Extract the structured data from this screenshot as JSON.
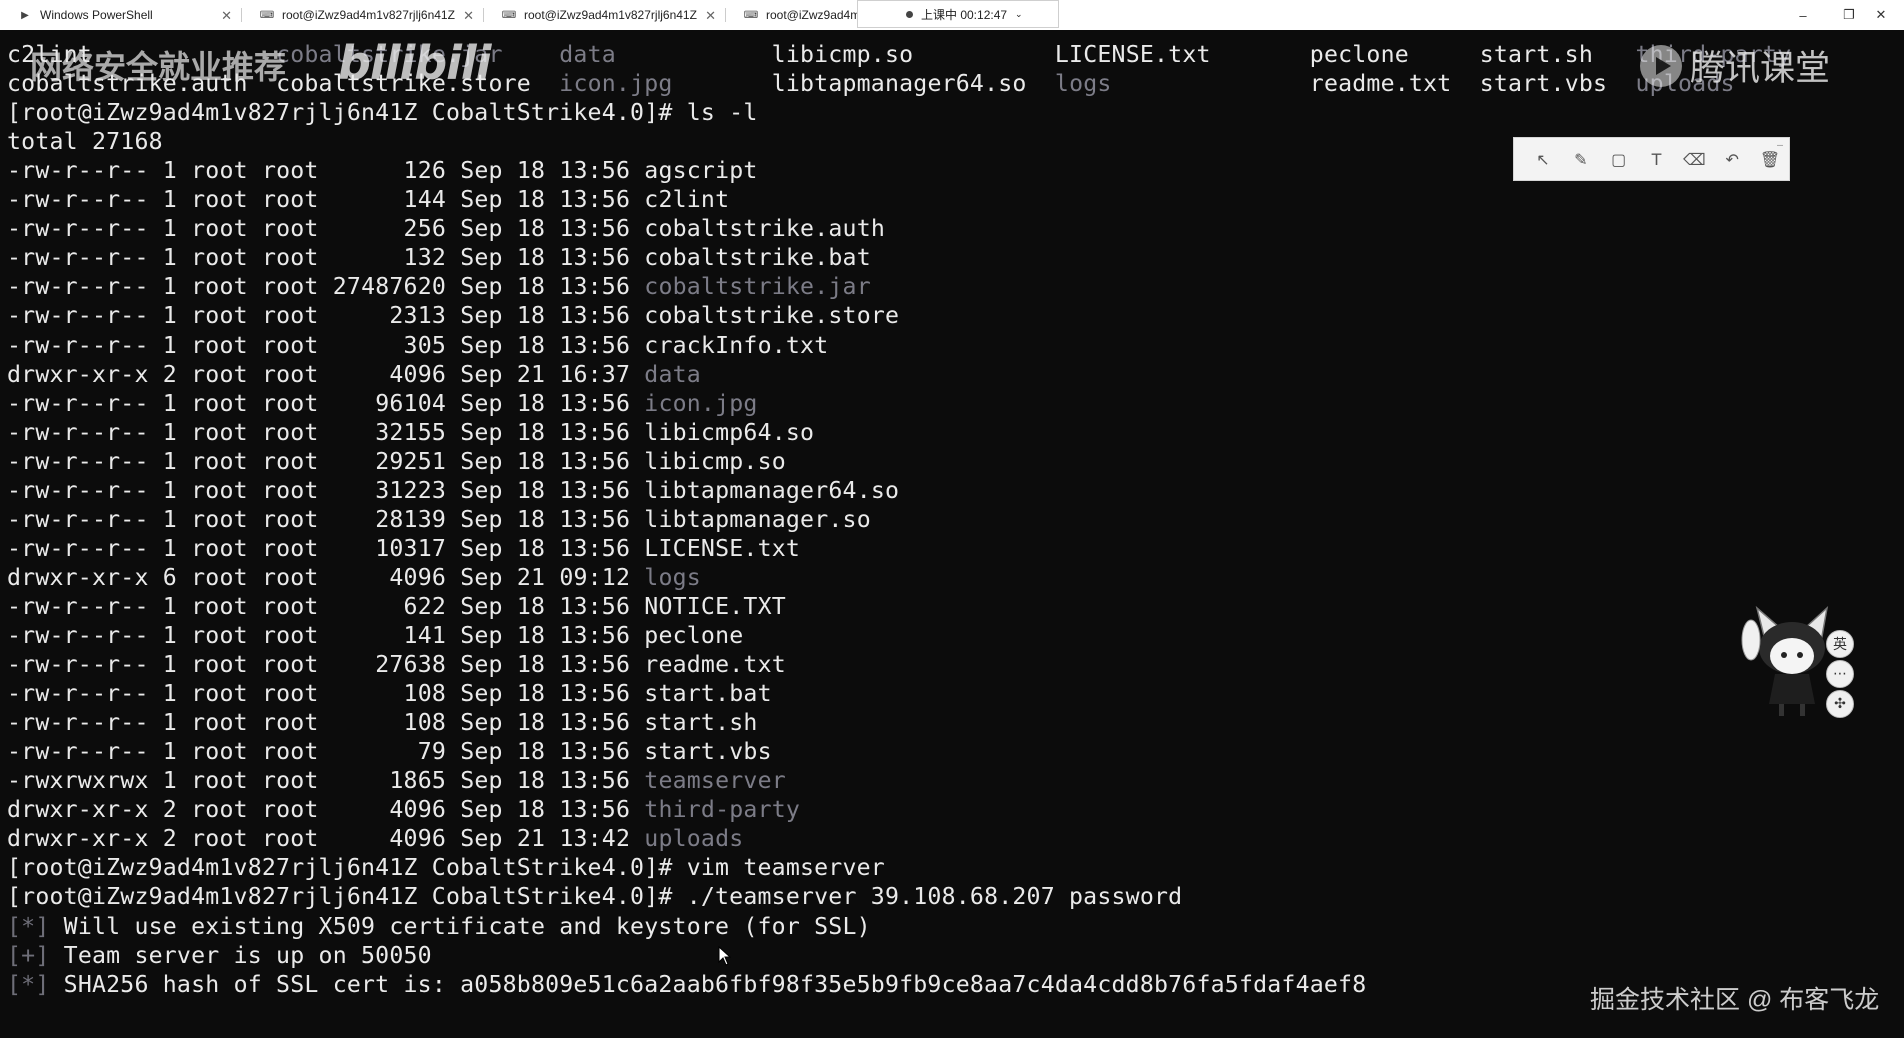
{
  "tabs": [
    {
      "label": "Windows PowerShell",
      "icon": "powershell-icon"
    },
    {
      "label": "root@iZwz9ad4m1v827rjlj6n41Z",
      "icon": "terminal-icon"
    },
    {
      "label": "root@iZwz9ad4m1v827rjlj6n41Z",
      "icon": "terminal-icon"
    },
    {
      "label": "root@iZwz9ad4m",
      "icon": "terminal-icon"
    }
  ],
  "recording": {
    "status": "上课中 00:12:47",
    "dropdown_icon": "chevron-down-icon"
  },
  "window_controls": {
    "minimize": "–",
    "maximize": "❐",
    "close": "✕"
  },
  "terminal": {
    "top_listing": [
      [
        "c2lint",
        "cobaltstrike.jar",
        "data",
        "libicmp.so",
        "LICENSE.txt",
        "peclone",
        "start.sh",
        "third-party"
      ],
      [
        "cobaltstrike.auth",
        "cobaltstrike.store",
        "icon.jpg",
        "libtapmanager64.so",
        "logs",
        "readme.txt",
        "start.vbs",
        "uploads"
      ]
    ],
    "prompt": "[root@iZwz9ad4m1v827rjlj6n41Z CobaltStrike4.0]#",
    "cmd_ls": "ls -l",
    "total": "total 27168",
    "entries": [
      {
        "perm": "-rw-r--r--",
        "links": "1",
        "owner": "root",
        "group": "root",
        "size": "126",
        "date": "Sep 18 13:56",
        "name": "agscript",
        "dim": false
      },
      {
        "perm": "-rw-r--r--",
        "links": "1",
        "owner": "root",
        "group": "root",
        "size": "144",
        "date": "Sep 18 13:56",
        "name": "c2lint",
        "dim": false
      },
      {
        "perm": "-rw-r--r--",
        "links": "1",
        "owner": "root",
        "group": "root",
        "size": "256",
        "date": "Sep 18 13:56",
        "name": "cobaltstrike.auth",
        "dim": false
      },
      {
        "perm": "-rw-r--r--",
        "links": "1",
        "owner": "root",
        "group": "root",
        "size": "132",
        "date": "Sep 18 13:56",
        "name": "cobaltstrike.bat",
        "dim": false
      },
      {
        "perm": "-rw-r--r--",
        "links": "1",
        "owner": "root",
        "group": "root",
        "size": "27487620",
        "date": "Sep 18 13:56",
        "name": "cobaltstrike.jar",
        "dim": true
      },
      {
        "perm": "-rw-r--r--",
        "links": "1",
        "owner": "root",
        "group": "root",
        "size": "2313",
        "date": "Sep 18 13:56",
        "name": "cobaltstrike.store",
        "dim": false
      },
      {
        "perm": "-rw-r--r--",
        "links": "1",
        "owner": "root",
        "group": "root",
        "size": "305",
        "date": "Sep 18 13:56",
        "name": "crackInfo.txt",
        "dim": false
      },
      {
        "perm": "drwxr-xr-x",
        "links": "2",
        "owner": "root",
        "group": "root",
        "size": "4096",
        "date": "Sep 21 16:37",
        "name": "data",
        "dim": true
      },
      {
        "perm": "-rw-r--r--",
        "links": "1",
        "owner": "root",
        "group": "root",
        "size": "96104",
        "date": "Sep 18 13:56",
        "name": "icon.jpg",
        "dim": true
      },
      {
        "perm": "-rw-r--r--",
        "links": "1",
        "owner": "root",
        "group": "root",
        "size": "32155",
        "date": "Sep 18 13:56",
        "name": "libicmp64.so",
        "dim": false
      },
      {
        "perm": "-rw-r--r--",
        "links": "1",
        "owner": "root",
        "group": "root",
        "size": "29251",
        "date": "Sep 18 13:56",
        "name": "libicmp.so",
        "dim": false
      },
      {
        "perm": "-rw-r--r--",
        "links": "1",
        "owner": "root",
        "group": "root",
        "size": "31223",
        "date": "Sep 18 13:56",
        "name": "libtapmanager64.so",
        "dim": false
      },
      {
        "perm": "-rw-r--r--",
        "links": "1",
        "owner": "root",
        "group": "root",
        "size": "28139",
        "date": "Sep 18 13:56",
        "name": "libtapmanager.so",
        "dim": false
      },
      {
        "perm": "-rw-r--r--",
        "links": "1",
        "owner": "root",
        "group": "root",
        "size": "10317",
        "date": "Sep 18 13:56",
        "name": "LICENSE.txt",
        "dim": false
      },
      {
        "perm": "drwxr-xr-x",
        "links": "6",
        "owner": "root",
        "group": "root",
        "size": "4096",
        "date": "Sep 21 09:12",
        "name": "logs",
        "dim": true
      },
      {
        "perm": "-rw-r--r--",
        "links": "1",
        "owner": "root",
        "group": "root",
        "size": "622",
        "date": "Sep 18 13:56",
        "name": "NOTICE.TXT",
        "dim": false
      },
      {
        "perm": "-rw-r--r--",
        "links": "1",
        "owner": "root",
        "group": "root",
        "size": "141",
        "date": "Sep 18 13:56",
        "name": "peclone",
        "dim": false
      },
      {
        "perm": "-rw-r--r--",
        "links": "1",
        "owner": "root",
        "group": "root",
        "size": "27638",
        "date": "Sep 18 13:56",
        "name": "readme.txt",
        "dim": false
      },
      {
        "perm": "-rw-r--r--",
        "links": "1",
        "owner": "root",
        "group": "root",
        "size": "108",
        "date": "Sep 18 13:56",
        "name": "start.bat",
        "dim": false
      },
      {
        "perm": "-rw-r--r--",
        "links": "1",
        "owner": "root",
        "group": "root",
        "size": "108",
        "date": "Sep 18 13:56",
        "name": "start.sh",
        "dim": false
      },
      {
        "perm": "-rw-r--r--",
        "links": "1",
        "owner": "root",
        "group": "root",
        "size": "79",
        "date": "Sep 18 13:56",
        "name": "start.vbs",
        "dim": false
      },
      {
        "perm": "-rwxrwxrwx",
        "links": "1",
        "owner": "root",
        "group": "root",
        "size": "1865",
        "date": "Sep 18 13:56",
        "name": "teamserver",
        "dim": true
      },
      {
        "perm": "drwxr-xr-x",
        "links": "2",
        "owner": "root",
        "group": "root",
        "size": "4096",
        "date": "Sep 18 13:56",
        "name": "third-party",
        "dim": true
      },
      {
        "perm": "drwxr-xr-x",
        "links": "2",
        "owner": "root",
        "group": "root",
        "size": "4096",
        "date": "Sep 21 13:42",
        "name": "uploads",
        "dim": true
      }
    ],
    "cmd_vim": "vim teamserver",
    "cmd_teamserver": "./teamserver 39.108.68.207 password",
    "output": [
      {
        "tag": "[*]",
        "text": "Will use existing X509 certificate and keystore (for SSL)"
      },
      {
        "tag": "[+]",
        "text": "Team server is up on 50050"
      },
      {
        "tag": "[*]",
        "text": "SHA256 hash of SSL cert is: a058b809e51c6a2aab6fbf98f35e5b9fb9ce8aa7c4da4cdd8b76fa5fdaf4aef8"
      }
    ]
  },
  "overlays": {
    "watermark_left": "网络安全就业推荐",
    "watermark_bilibili": "bilibili",
    "watermark_tencent": "腾讯课堂",
    "credit": "掘金技术社区 @ 布客飞龙",
    "draw_tools": [
      "pointer-icon",
      "pen-icon",
      "rectangle-icon",
      "text-icon",
      "eraser-icon",
      "undo-icon",
      "delete-icon"
    ],
    "draw_tool_glyphs": [
      "↖",
      "✎",
      "▢",
      "T",
      "⌫",
      "↶",
      "🗑"
    ],
    "side_buttons": [
      {
        "icon": "language-icon",
        "label": "英"
      },
      {
        "icon": "dots-icon",
        "label": "⋯"
      },
      {
        "icon": "butterfly-icon",
        "label": "✣"
      }
    ]
  }
}
